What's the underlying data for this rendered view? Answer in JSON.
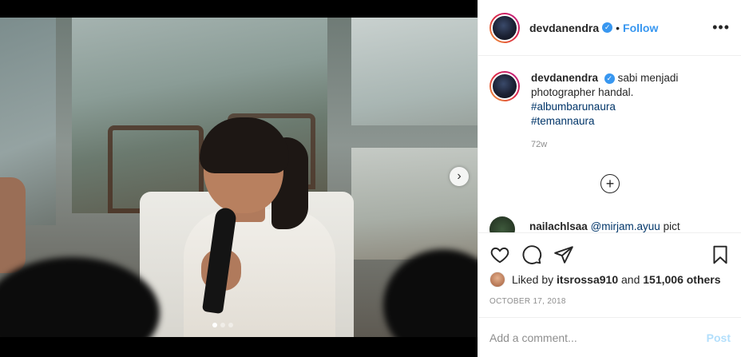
{
  "post": {
    "author": "devdanendra",
    "follow_label": "Follow",
    "separator": "•",
    "more_label": "•••",
    "verified_mark": "✓"
  },
  "caption": {
    "author": "devdanendra",
    "text": "sabi menjadi photographer handal.",
    "hashtags": [
      "#albumbarunaura",
      "#temannaura"
    ],
    "age": "72w"
  },
  "load_more_label": "+",
  "comment": {
    "author": "nailachlsaa",
    "mention": "@mirjam.ayuu",
    "text": "pict"
  },
  "likes": {
    "prefix": "Liked by",
    "user": "itsrossa910",
    "and": "and",
    "count": "151,006 others"
  },
  "date": "OCTOBER 17, 2018",
  "add_comment": {
    "placeholder": "Add a comment...",
    "post_label": "Post"
  },
  "carousel": {
    "next_label": "›",
    "slide_count": 3,
    "active_slide": 1
  },
  "colors": {
    "link": "#3897f0",
    "hashtag": "#003569",
    "muted": "#8e8e8e",
    "post_disabled": "#b2dffc"
  },
  "icons": [
    "heart-icon",
    "comment-icon",
    "share-icon",
    "bookmark-icon",
    "verified-badge-icon",
    "more-options-icon",
    "load-more-icon",
    "chevron-right-icon"
  ]
}
